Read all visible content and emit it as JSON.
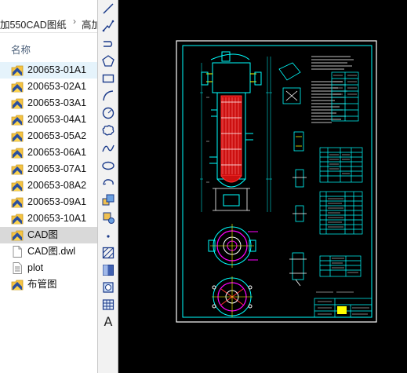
{
  "explorer": {
    "breadcrumb": [
      "加550CAD图纸",
      "高加"
    ],
    "breadcrumb_separator": "›",
    "column_header": "名称",
    "files": [
      {
        "name": "200653-01A1",
        "type": "dwg",
        "state": "hover"
      },
      {
        "name": "200653-02A1",
        "type": "dwg",
        "state": "none"
      },
      {
        "name": "200653-03A1",
        "type": "dwg",
        "state": "none"
      },
      {
        "name": "200653-04A1",
        "type": "dwg",
        "state": "none"
      },
      {
        "name": "200653-05A2",
        "type": "dwg",
        "state": "none"
      },
      {
        "name": "200653-06A1",
        "type": "dwg",
        "state": "none"
      },
      {
        "name": "200653-07A1",
        "type": "dwg",
        "state": "none"
      },
      {
        "name": "200653-08A2",
        "type": "dwg",
        "state": "none"
      },
      {
        "name": "200653-09A1",
        "type": "dwg",
        "state": "none"
      },
      {
        "name": "200653-10A1",
        "type": "dwg",
        "state": "none"
      },
      {
        "name": "CAD图",
        "type": "dwg",
        "state": "selected"
      },
      {
        "name": "CAD图.dwl",
        "type": "blank",
        "state": "none"
      },
      {
        "name": "plot",
        "type": "text",
        "state": "none"
      },
      {
        "name": "布管图",
        "type": "dwg",
        "state": "none"
      }
    ]
  },
  "toolbar": {
    "tools": [
      "line-icon",
      "polyline-icon",
      "arc-polyline-icon",
      "polygon-icon",
      "rectangle-icon",
      "arc-icon",
      "circle-icon",
      "revision-cloud-icon",
      "spline-icon",
      "ellipse-icon",
      "ellipse-arc-icon",
      "insert-block-icon",
      "make-block-icon",
      "point-icon",
      "hatch-icon",
      "gradient-icon",
      "region-icon",
      "table-icon",
      "multiline-text-icon"
    ],
    "text_tool_glyph": "A"
  },
  "colors": {
    "canvas_background": "#000000",
    "drawing_border": "#ffffff",
    "drawing_cyan": "#00ffff",
    "drawing_red": "#ff2020",
    "drawing_magenta": "#ff00ff",
    "drawing_yellow": "#ffff00",
    "selection_light": "#e5f3fb",
    "selection_grey": "#d9d9d9",
    "folder_icon_yellow": "#f5c342"
  }
}
